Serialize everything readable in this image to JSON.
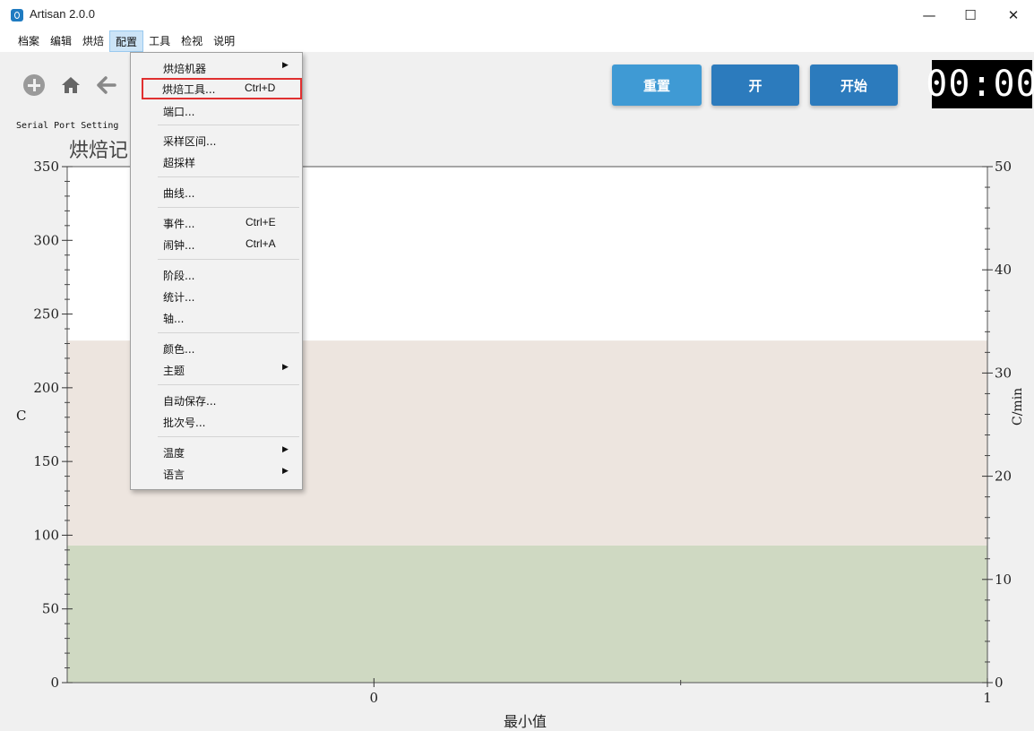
{
  "window": {
    "title": "Artisan 2.0.0",
    "controls": {
      "minimize": "—",
      "maximize": "☐",
      "close": "✕"
    }
  },
  "menubar": {
    "items": [
      "档案",
      "编辑",
      "烘焙",
      "配置",
      "工具",
      "检视",
      "说明"
    ],
    "active": "配置"
  },
  "toolbar": {
    "icons": [
      "plus-circle-icon",
      "home-icon",
      "back-arrow-icon"
    ],
    "serial_label": "Serial Port Setting",
    "chart_title": "烘焙记"
  },
  "buttons": {
    "reset": "重置",
    "on": "开",
    "start": "开始"
  },
  "timer": "00:00",
  "colors": {
    "button_light": "#3f9ad4",
    "button_dark": "#2c7bbd",
    "highlight_border": "#e03030",
    "band_upper": "#ede5df",
    "band_lower": "#cfd9c2"
  },
  "dropdown": {
    "items": [
      {
        "label": "烘焙机器",
        "shortcut": "",
        "submenu": true
      },
      {
        "label": "烘焙工具...",
        "shortcut": "Ctrl+D",
        "submenu": false,
        "highlighted": true
      },
      {
        "label": "端口...",
        "shortcut": "",
        "submenu": false
      },
      {
        "label": "采样区间...",
        "shortcut": "",
        "submenu": false
      },
      {
        "label": "超採样",
        "shortcut": "",
        "submenu": false
      },
      {
        "label": "曲线...",
        "shortcut": "",
        "submenu": false
      },
      {
        "label": "事件...",
        "shortcut": "Ctrl+E",
        "submenu": false
      },
      {
        "label": "闹钟...",
        "shortcut": "Ctrl+A",
        "submenu": false
      },
      {
        "label": "阶段...",
        "shortcut": "",
        "submenu": false
      },
      {
        "label": "统计...",
        "shortcut": "",
        "submenu": false
      },
      {
        "label": "轴...",
        "shortcut": "",
        "submenu": false
      },
      {
        "label": "颜色...",
        "shortcut": "",
        "submenu": false
      },
      {
        "label": "主题",
        "shortcut": "",
        "submenu": true
      },
      {
        "label": "自动保存...",
        "shortcut": "",
        "submenu": false
      },
      {
        "label": "批次号...",
        "shortcut": "",
        "submenu": false
      },
      {
        "label": "温度",
        "shortcut": "",
        "submenu": true
      },
      {
        "label": "语言",
        "shortcut": "",
        "submenu": true
      }
    ]
  },
  "chart_data": {
    "type": "area",
    "xlabel": "最小值",
    "ylabel": "C",
    "ylabel_right": "C/min",
    "xlim": [
      -0.5,
      1
    ],
    "x_ticks": [
      "0",
      "1"
    ],
    "ylim": [
      0,
      350
    ],
    "y_ticks": [
      "0",
      "50",
      "100",
      "150",
      "200",
      "250",
      "300",
      "350"
    ],
    "ylim_right": [
      0,
      50
    ],
    "y_ticks_right": [
      "0",
      "10",
      "20",
      "30",
      "40",
      "50"
    ],
    "bands": [
      {
        "from": 0,
        "to": 93,
        "color": "#cfd9c2"
      },
      {
        "from": 93,
        "to": 232,
        "color": "#ede5df"
      }
    ],
    "grid": false
  }
}
